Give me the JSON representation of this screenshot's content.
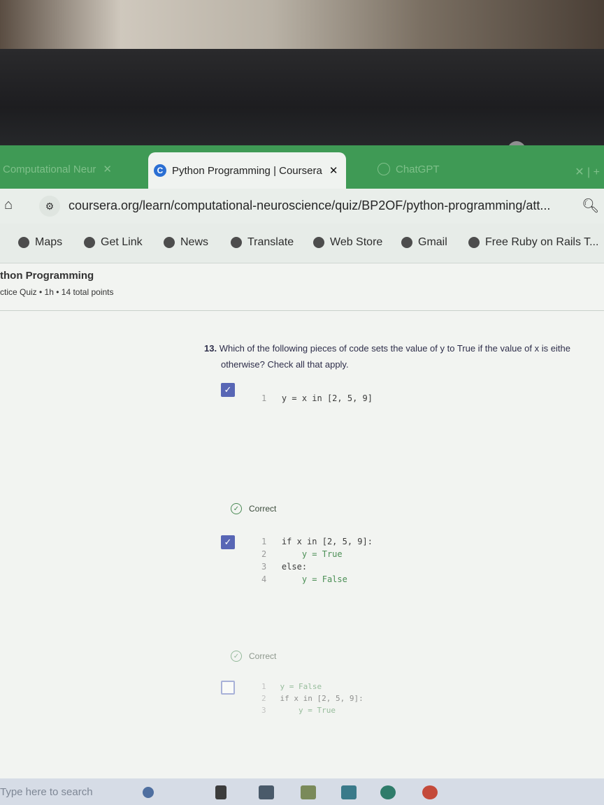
{
  "browser": {
    "tabs": [
      {
        "label": "Computational Neur",
        "close": "✕",
        "active": false
      },
      {
        "label": "Python Programming | Coursera",
        "close": "✕",
        "active": true,
        "favicon": "C"
      },
      {
        "label": "ChatGPT",
        "active": false
      }
    ],
    "tab_controls": "✕ | +",
    "url": "coursera.org/learn/computational-neuroscience/quiz/BP2OF/python-programming/att...",
    "bookmarks": [
      {
        "label": "Maps",
        "icon": "globe-icon"
      },
      {
        "label": "Get Link",
        "icon": "globe-icon"
      },
      {
        "label": "News",
        "icon": "globe-icon"
      },
      {
        "label": "Translate",
        "icon": "globe-icon"
      },
      {
        "label": "Web Store",
        "icon": "globe-icon"
      },
      {
        "label": "Gmail",
        "icon": "globe-icon"
      },
      {
        "label": "Free Ruby on Rails T...",
        "icon": "globe-icon"
      }
    ]
  },
  "course": {
    "title": "thon Programming",
    "subtitle": "ctice Quiz • 1h • 14 total points"
  },
  "question": {
    "number": "13.",
    "text": "Which of the following pieces of code sets the value of y to True if the value of x is eithe",
    "text_line2": "otherwise? Check all that apply.",
    "options": [
      {
        "checked": true,
        "lines": [
          {
            "n": "1",
            "code": "y = x in [2, 5, 9]"
          }
        ],
        "feedback": "Correct"
      },
      {
        "checked": true,
        "lines": [
          {
            "n": "1",
            "code": "if x in [2, 5, 9]:"
          },
          {
            "n": "2",
            "code": "    y = True"
          },
          {
            "n": "3",
            "code": "else:"
          },
          {
            "n": "4",
            "code": "    y = False"
          }
        ],
        "feedback": "Correct"
      },
      {
        "checked": false,
        "lines": [
          {
            "n": "1",
            "code": "y = False"
          },
          {
            "n": "2",
            "code": "if x in [2, 5, 9]:"
          },
          {
            "n": "3",
            "code": "    y = True"
          }
        ]
      }
    ]
  },
  "taskbar": {
    "search_placeholder": "Type here to search"
  },
  "colors": {
    "tabbar": "#3f9a55",
    "checkbox": "#5866b5",
    "correct": "#4a8a55"
  }
}
